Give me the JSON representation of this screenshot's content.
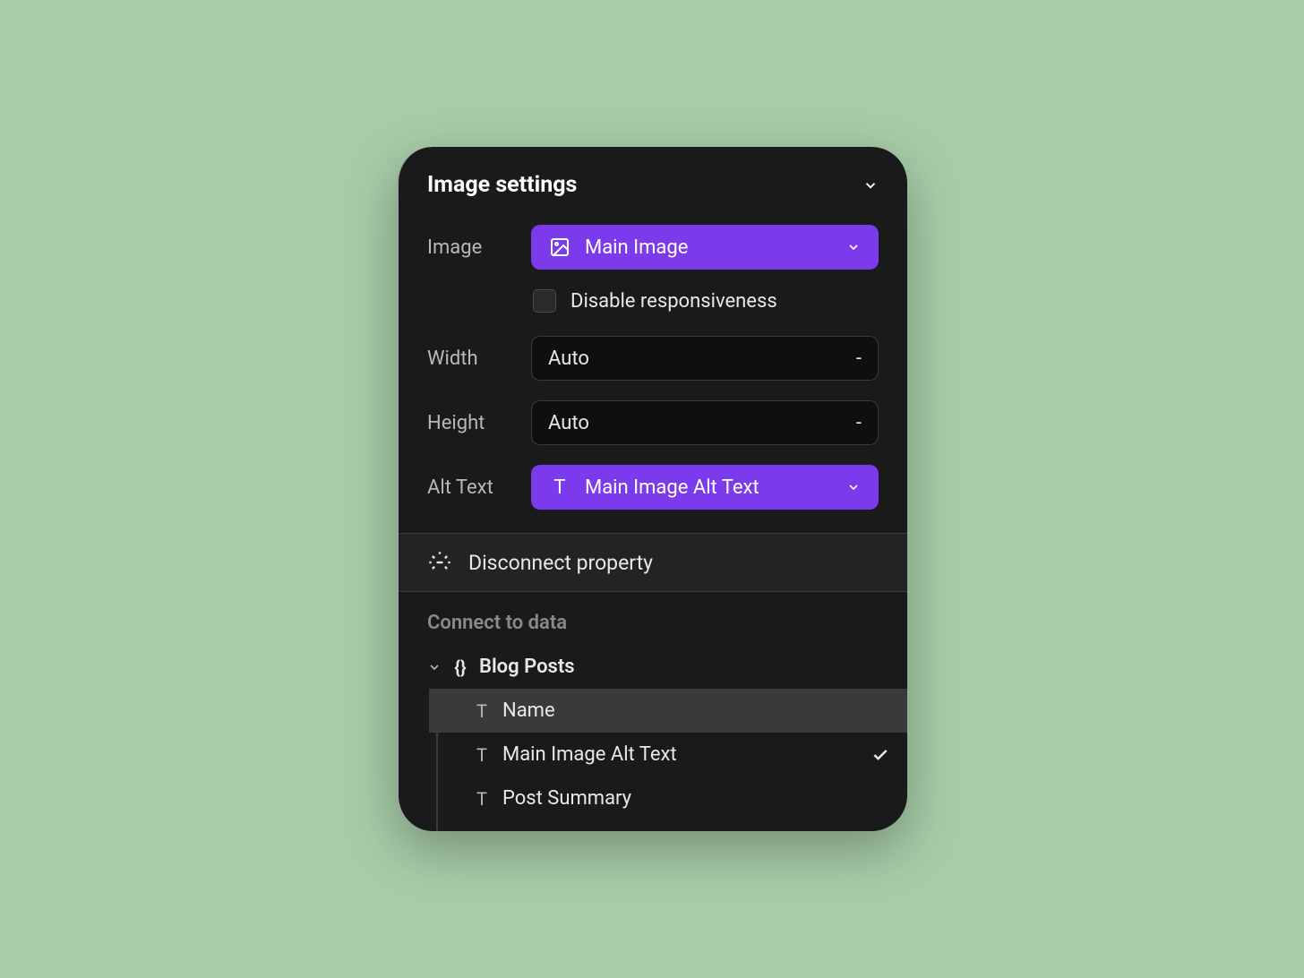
{
  "panel": {
    "title": "Image settings"
  },
  "fields": {
    "image_label": "Image",
    "image_value": "Main Image",
    "disable_responsiveness_label": "Disable responsiveness",
    "width_label": "Width",
    "width_value": "Auto",
    "height_label": "Height",
    "height_value": "Auto",
    "alt_text_label": "Alt Text",
    "alt_text_value": "Main Image Alt Text"
  },
  "disconnect": {
    "label": "Disconnect property"
  },
  "connect": {
    "title": "Connect to data",
    "group": "Blog Posts",
    "items": [
      {
        "label": "Name",
        "selected": false,
        "highlighted": true
      },
      {
        "label": "Main Image Alt Text",
        "selected": true,
        "highlighted": false
      },
      {
        "label": "Post Summary",
        "selected": false,
        "highlighted": false
      }
    ]
  }
}
